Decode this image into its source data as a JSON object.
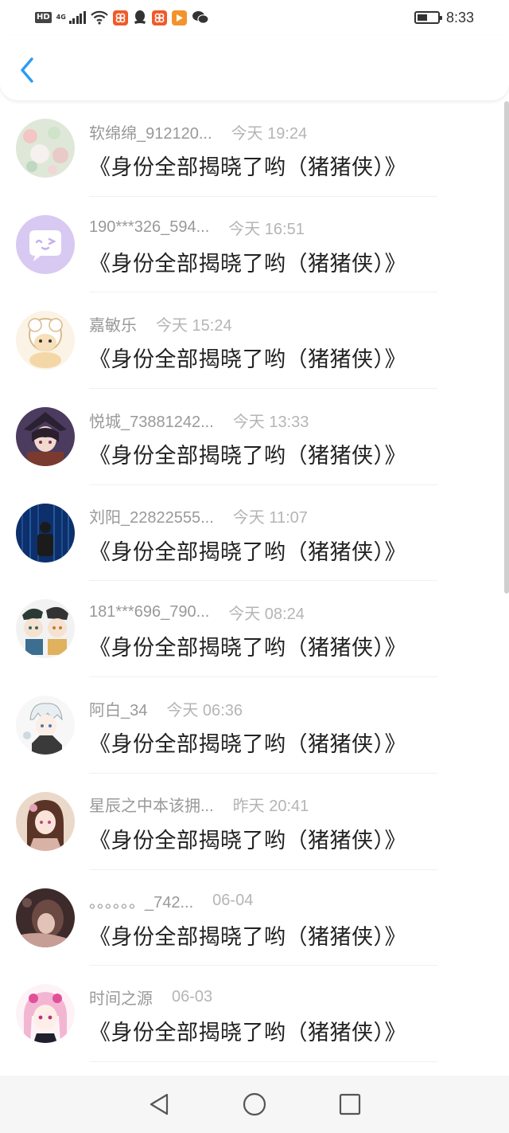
{
  "status_bar": {
    "network_badge": "HD",
    "network_type": "4G",
    "time": "8:33",
    "icons": [
      "wifi-icon",
      "app-notification-icon",
      "qq-icon",
      "app-notification-icon",
      "video-app-icon",
      "wechat-icon"
    ]
  },
  "header": {
    "back_icon": "chevron-left-icon",
    "accent_color": "#2b9cf2"
  },
  "messages": [
    {
      "username": "软绵绵_912120...",
      "time": "今天 19:24",
      "title": "《身份全部揭晓了哟（猪猪侠）》"
    },
    {
      "username": "190***326_594...",
      "time": "今天 16:51",
      "title": "《身份全部揭晓了哟（猪猪侠）》"
    },
    {
      "username": "嘉敏乐",
      "time": "今天 15:24",
      "title": "《身份全部揭晓了哟（猪猪侠）》"
    },
    {
      "username": "悦城_73881242...",
      "time": "今天 13:33",
      "title": "《身份全部揭晓了哟（猪猪侠）》"
    },
    {
      "username": "刘阳_22822555...",
      "time": "今天 11:07",
      "title": "《身份全部揭晓了哟（猪猪侠）》"
    },
    {
      "username": "181***696_790...",
      "time": "今天 08:24",
      "title": "《身份全部揭晓了哟（猪猪侠）》"
    },
    {
      "username": "阿白_34",
      "time": "今天 06:36",
      "title": "《身份全部揭晓了哟（猪猪侠）》"
    },
    {
      "username": "星辰之中本该拥...",
      "time": "昨天 20:41",
      "title": "《身份全部揭晓了哟（猪猪侠）》"
    },
    {
      "username": "。。。。。。_742...",
      "time": "06-04",
      "title": "《身份全部揭晓了哟（猪猪侠）》"
    },
    {
      "username": "时间之源",
      "time": "06-03",
      "title": "《身份全部揭晓了哟（猪猪侠）》"
    }
  ],
  "nav_bar": {
    "back_icon": "triangle-back-icon",
    "home_icon": "circle-home-icon",
    "recents_icon": "square-recents-icon"
  }
}
